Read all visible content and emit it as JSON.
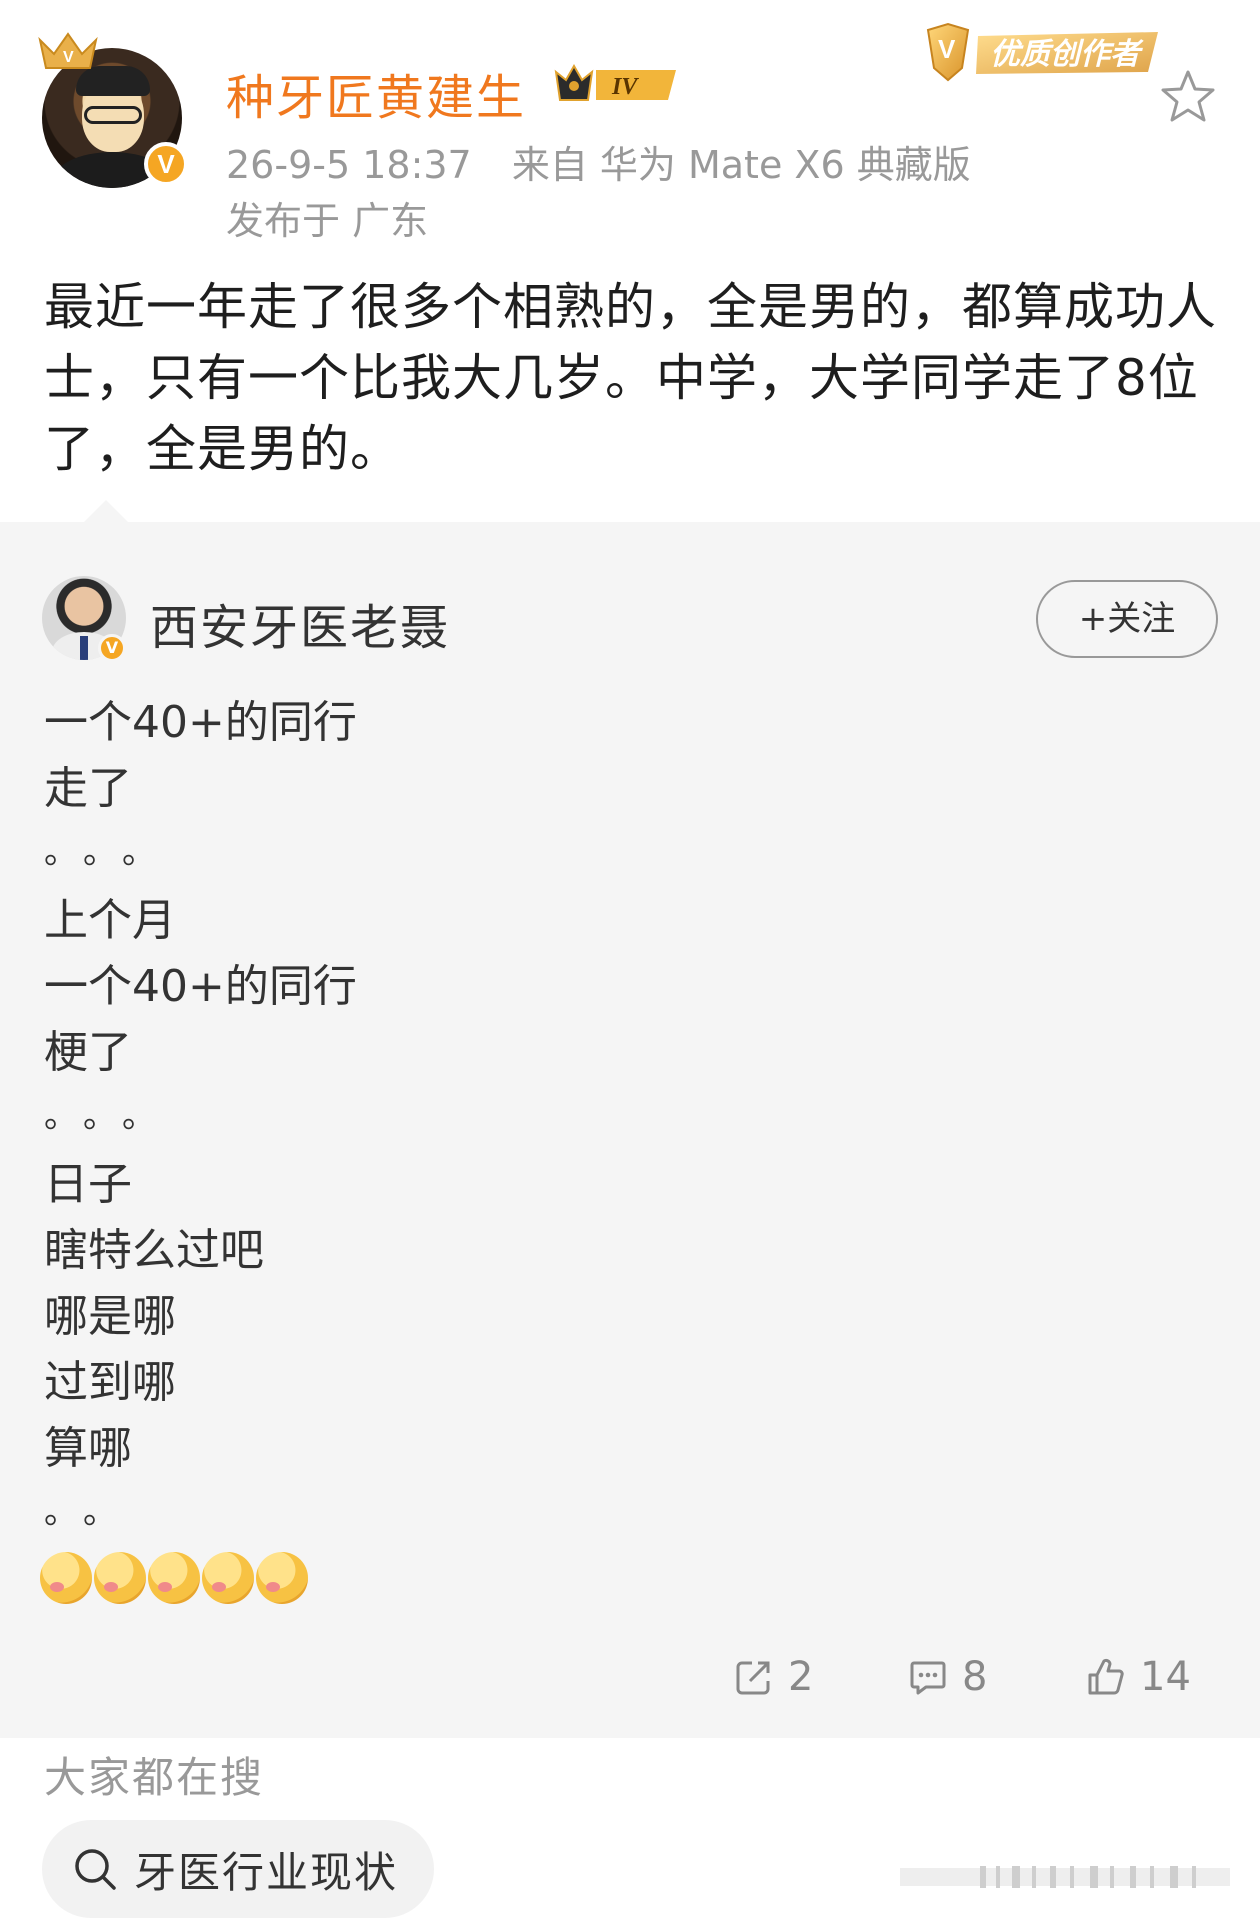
{
  "post": {
    "username": "种牙匠黄建生",
    "level_badge": "IV",
    "time": "26-9-5 18:37",
    "source": "来自 华为 Mate X6 典藏版",
    "location": "发布于 广东",
    "creator_badge": "优质创作者",
    "text": "最近一年走了很多个相熟的，全是男的，都算成功人士，只有一个比我大几岁。中学，大学同学走了8位了，全是男的。"
  },
  "quoted": {
    "username": "西安牙医老聂",
    "follow_label": "+关注",
    "lines": [
      {
        "type": "text",
        "text": "一个40+的同行"
      },
      {
        "type": "text",
        "text": "走了"
      },
      {
        "type": "dots",
        "text": "。。。"
      },
      {
        "type": "text",
        "text": "上个月"
      },
      {
        "type": "text",
        "text": "一个40+的同行"
      },
      {
        "type": "text",
        "text": "梗了"
      },
      {
        "type": "dots",
        "text": "。。。"
      },
      {
        "type": "text",
        "text": "日子"
      },
      {
        "type": "text",
        "text": "瞎特么过吧"
      },
      {
        "type": "text",
        "text": "哪是哪"
      },
      {
        "type": "text",
        "text": "过到哪"
      },
      {
        "type": "text",
        "text": "算哪"
      },
      {
        "type": "dots",
        "text": "。。"
      }
    ],
    "emoji_count": 5,
    "emoji_name": "drooling-face-emoji",
    "actions": {
      "repost_count": "2",
      "comment_count": "8",
      "like_count": "14"
    }
  },
  "search": {
    "title": "大家都在搜",
    "query": "牙医行业现状"
  },
  "colors": {
    "username": "#f0781e",
    "meta": "#999999",
    "quoted_bg": "#f5f5f5",
    "verified": "#f5a623"
  }
}
